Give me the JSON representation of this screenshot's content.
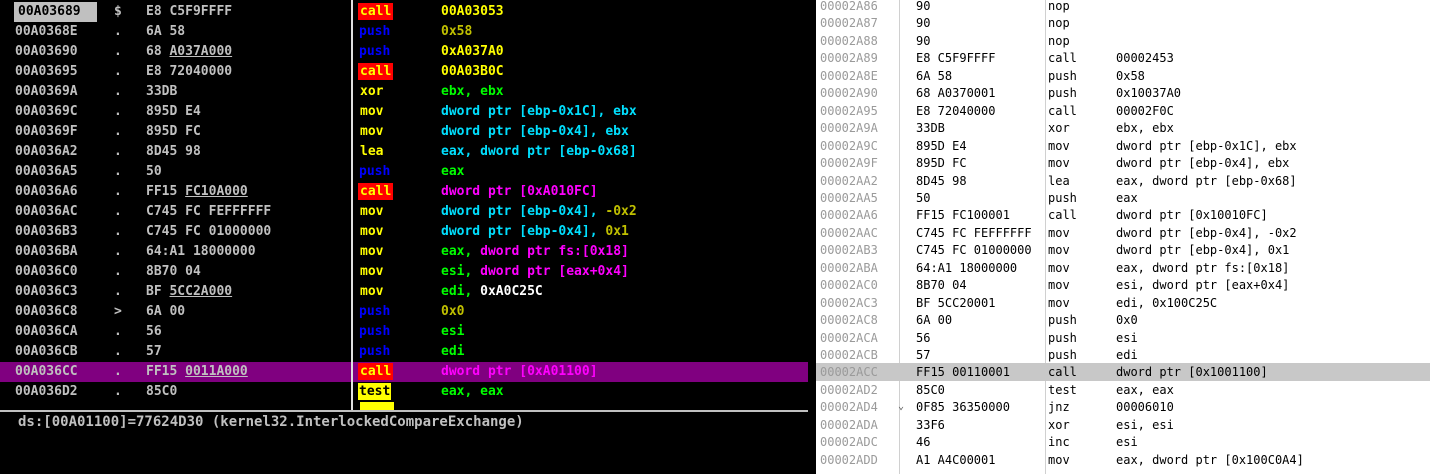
{
  "olly": {
    "rows": [
      {
        "addr": "00A03689",
        "mark": "$",
        "bytes_pre": "E8 C5F9FFFF",
        "bytes_u": "",
        "bytes_post": "",
        "mnemonic": "call",
        "mtype": "call",
        "ops": "00A03053",
        "otype": "call",
        "neg": ""
      },
      {
        "addr": "00A0368E",
        "mark": ".",
        "bytes_pre": "6A 58",
        "bytes_u": "",
        "bytes_post": "",
        "mnemonic": "push",
        "mtype": "push",
        "ops": "0x58",
        "otype": "olive",
        "neg": ""
      },
      {
        "addr": "00A03690",
        "mark": ".",
        "bytes_pre": "68 ",
        "bytes_u": "A037A000",
        "bytes_post": "",
        "mnemonic": "push",
        "mtype": "push",
        "ops": "0xA037A0",
        "otype": "call",
        "neg": ""
      },
      {
        "addr": "00A03695",
        "mark": ".",
        "bytes_pre": "E8 72040000",
        "bytes_u": "",
        "bytes_post": "",
        "mnemonic": "call",
        "mtype": "call",
        "ops": "00A03B0C",
        "otype": "call",
        "neg": ""
      },
      {
        "addr": "00A0369A",
        "mark": ".",
        "bytes_pre": "33DB",
        "bytes_u": "",
        "bytes_post": "",
        "mnemonic": "xor",
        "mtype": "xor",
        "ops": "ebx, ebx",
        "otype": "green",
        "neg": ""
      },
      {
        "addr": "00A0369C",
        "mark": ".",
        "bytes_pre": "895D E4",
        "bytes_u": "",
        "bytes_post": "",
        "mnemonic": "mov",
        "mtype": "mov",
        "ops": "dword ptr [ebp-0x1C], ebx",
        "otype": "cyanmix",
        "neg": ""
      },
      {
        "addr": "00A0369F",
        "mark": ".",
        "bytes_pre": "895D FC",
        "bytes_u": "",
        "bytes_post": "",
        "mnemonic": "mov",
        "mtype": "mov",
        "ops": "dword ptr [ebp-0x4], ebx",
        "otype": "cyanmix",
        "neg": ""
      },
      {
        "addr": "00A036A2",
        "mark": ".",
        "bytes_pre": "8D45 98",
        "bytes_u": "",
        "bytes_post": "",
        "mnemonic": "lea",
        "mtype": "lea",
        "ops": "eax, dword ptr [ebp-0x68]",
        "otype": "cyanmix",
        "neg": ""
      },
      {
        "addr": "00A036A5",
        "mark": ".",
        "bytes_pre": "50",
        "bytes_u": "",
        "bytes_post": "",
        "mnemonic": "push",
        "mtype": "push",
        "ops": "eax",
        "otype": "green",
        "neg": ""
      },
      {
        "addr": "00A036A6",
        "mark": ".",
        "bytes_pre": "FF15 ",
        "bytes_u": "FC10A000",
        "bytes_post": "",
        "mnemonic": "call",
        "mtype": "call",
        "ops": "dword ptr [0xA010FC]",
        "otype": "mem",
        "neg": ""
      },
      {
        "addr": "00A036AC",
        "mark": ".",
        "bytes_pre": "C745 FC FEFFFFFF",
        "bytes_u": "",
        "bytes_post": "",
        "mnemonic": "mov",
        "mtype": "mov",
        "ops": "dword ptr [ebp-0x4], ",
        "otype": "cyanmix",
        "neg": "-0x2"
      },
      {
        "addr": "00A036B3",
        "mark": ".",
        "bytes_pre": "C745 FC 01000000",
        "bytes_u": "",
        "bytes_post": "",
        "mnemonic": "mov",
        "mtype": "mov",
        "ops": "dword ptr [ebp-0x4], ",
        "otype": "cyanmix",
        "neg": "0x1"
      },
      {
        "addr": "00A036BA",
        "mark": ".",
        "bytes_pre": "64:A1 18000000",
        "bytes_u": "",
        "bytes_post": "",
        "mnemonic": "mov",
        "mtype": "mov",
        "ops": "eax, dword ptr fs:[0x18]",
        "otype": "fsmix",
        "neg": ""
      },
      {
        "addr": "00A036C0",
        "mark": ".",
        "bytes_pre": "8B70 04",
        "bytes_u": "",
        "bytes_post": "",
        "mnemonic": "mov",
        "mtype": "mov",
        "ops": "esi, dword ptr [eax+0x4]",
        "otype": "esimix",
        "neg": ""
      },
      {
        "addr": "00A036C3",
        "mark": ".",
        "bytes_pre": "BF ",
        "bytes_u": "5CC2A000",
        "bytes_post": "",
        "mnemonic": "mov",
        "mtype": "mov",
        "ops": "edi, 0xA0C25C",
        "otype": "edimix",
        "neg": ""
      },
      {
        "addr": "00A036C8",
        "mark": ">",
        "bytes_pre": "6A 00",
        "bytes_u": "",
        "bytes_post": "",
        "mnemonic": "push",
        "mtype": "push",
        "ops": "0x0",
        "otype": "olive",
        "neg": ""
      },
      {
        "addr": "00A036CA",
        "mark": ".",
        "bytes_pre": "56",
        "bytes_u": "",
        "bytes_post": "",
        "mnemonic": "push",
        "mtype": "push",
        "ops": "esi",
        "otype": "green",
        "neg": ""
      },
      {
        "addr": "00A036CB",
        "mark": ".",
        "bytes_pre": "57",
        "bytes_u": "",
        "bytes_post": "",
        "mnemonic": "push",
        "mtype": "push",
        "ops": "edi",
        "otype": "green",
        "neg": ""
      },
      {
        "addr": "00A036CC",
        "mark": ".",
        "bytes_pre": "FF15 ",
        "bytes_u": "0011A000",
        "bytes_post": "",
        "mnemonic": "call",
        "mtype": "call",
        "ops": "dword ptr [0xA01100]",
        "otype": "callm",
        "neg": "",
        "selected": true
      },
      {
        "addr": "00A036D2",
        "mark": ".",
        "bytes_pre": "85C0",
        "bytes_u": "",
        "bytes_post": "",
        "mnemonic": "test",
        "mtype": "test",
        "ops": "eax, eax",
        "otype": "green",
        "neg": ""
      }
    ],
    "info": "ds:[00A01100]=77624D30 (kernel32.InterlockedCompareExchange)"
  },
  "ida": {
    "rows": [
      {
        "addr": "00002A86",
        "arrow": "",
        "bytes": "90",
        "mnemonic": "nop",
        "ops": ""
      },
      {
        "addr": "00002A87",
        "arrow": "",
        "bytes": "90",
        "mnemonic": "nop",
        "ops": ""
      },
      {
        "addr": "00002A88",
        "arrow": "",
        "bytes": "90",
        "mnemonic": "nop",
        "ops": ""
      },
      {
        "addr": "00002A89",
        "arrow": "",
        "bytes": "E8 C5F9FFFF",
        "mnemonic": "call",
        "ops": "00002453"
      },
      {
        "addr": "00002A8E",
        "arrow": "",
        "bytes": "6A 58",
        "mnemonic": "push",
        "ops": "0x58"
      },
      {
        "addr": "00002A90",
        "arrow": "",
        "bytes": "68 A0370001",
        "mnemonic": "push",
        "ops": "0x10037A0"
      },
      {
        "addr": "00002A95",
        "arrow": "",
        "bytes": "E8 72040000",
        "mnemonic": "call",
        "ops": "00002F0C"
      },
      {
        "addr": "00002A9A",
        "arrow": "",
        "bytes": "33DB",
        "mnemonic": "xor",
        "ops": "ebx, ebx"
      },
      {
        "addr": "00002A9C",
        "arrow": "",
        "bytes": "895D E4",
        "mnemonic": "mov",
        "ops": "dword ptr [ebp-0x1C], ebx"
      },
      {
        "addr": "00002A9F",
        "arrow": "",
        "bytes": "895D FC",
        "mnemonic": "mov",
        "ops": "dword ptr [ebp-0x4], ebx"
      },
      {
        "addr": "00002AA2",
        "arrow": "",
        "bytes": "8D45 98",
        "mnemonic": "lea",
        "ops": "eax, dword ptr [ebp-0x68]"
      },
      {
        "addr": "00002AA5",
        "arrow": "",
        "bytes": "50",
        "mnemonic": "push",
        "ops": "eax"
      },
      {
        "addr": "00002AA6",
        "arrow": "",
        "bytes": "FF15 FC100001",
        "mnemonic": "call",
        "ops": "dword ptr [0x10010FC]"
      },
      {
        "addr": "00002AAC",
        "arrow": "",
        "bytes": "C745 FC FEFFFFFF",
        "mnemonic": "mov",
        "ops": "dword ptr [ebp-0x4], -0x2"
      },
      {
        "addr": "00002AB3",
        "arrow": "",
        "bytes": "C745 FC 01000000",
        "mnemonic": "mov",
        "ops": "dword ptr [ebp-0x4], 0x1"
      },
      {
        "addr": "00002ABA",
        "arrow": "",
        "bytes": "64:A1 18000000",
        "mnemonic": "mov",
        "ops": "eax, dword ptr fs:[0x18]"
      },
      {
        "addr": "00002AC0",
        "arrow": "",
        "bytes": "8B70 04",
        "mnemonic": "mov",
        "ops": "esi, dword ptr [eax+0x4]"
      },
      {
        "addr": "00002AC3",
        "arrow": "",
        "bytes": "BF 5CC20001",
        "mnemonic": "mov",
        "ops": "edi, 0x100C25C"
      },
      {
        "addr": "00002AC8",
        "arrow": "",
        "bytes": "6A 00",
        "mnemonic": "push",
        "ops": "0x0"
      },
      {
        "addr": "00002ACA",
        "arrow": "",
        "bytes": "56",
        "mnemonic": "push",
        "ops": "esi"
      },
      {
        "addr": "00002ACB",
        "arrow": "",
        "bytes": "57",
        "mnemonic": "push",
        "ops": "edi"
      },
      {
        "addr": "00002ACC",
        "arrow": "",
        "bytes": "FF15 00110001",
        "mnemonic": "call",
        "ops": "dword ptr [0x1001100]",
        "selected": true
      },
      {
        "addr": "00002AD2",
        "arrow": "",
        "bytes": "85C0",
        "mnemonic": "test",
        "ops": "eax, eax"
      },
      {
        "addr": "00002AD4",
        "arrow": "⌄",
        "bytes": "0F85 36350000",
        "mnemonic": "jnz",
        "ops": "00006010"
      },
      {
        "addr": "00002ADA",
        "arrow": "",
        "bytes": "33F6",
        "mnemonic": "xor",
        "ops": "esi, esi"
      },
      {
        "addr": "00002ADC",
        "arrow": "",
        "bytes": "46",
        "mnemonic": "inc",
        "ops": "esi"
      },
      {
        "addr": "00002ADD",
        "arrow": "",
        "bytes": "A1 A4C00001",
        "mnemonic": "mov",
        "ops": "eax, dword ptr [0x100C0A4]"
      }
    ]
  }
}
